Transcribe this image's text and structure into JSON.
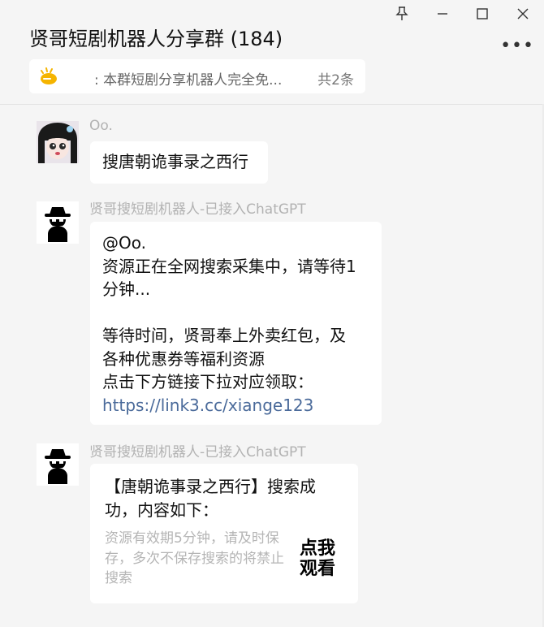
{
  "window": {
    "title": "贤哥短剧机器人分享群 (184)",
    "controls": [
      "pin-icon",
      "minimize-icon",
      "maximize-icon",
      "close-icon"
    ],
    "more_label": "•••"
  },
  "notice": {
    "icon": "bulb-icon",
    "text": ": 本群短剧分享机器人完全免...",
    "count": "共2条"
  },
  "messages": [
    {
      "sender": "Oo.",
      "avatar": "anime-girl-avatar",
      "lines": [
        "搜唐朝诡事录之西行"
      ]
    },
    {
      "sender": "贤哥搜短剧机器人-已接入ChatGPT",
      "avatar": "spy-avatar",
      "lines": [
        "@Oo.",
        "资源正在全网搜索采集中，请等待1",
        "分钟...",
        "",
        "等待时间，贤哥奉上外卖红包，及",
        "各种优惠券等福利资源",
        "点击下方链接下拉对应领取：",
        "https://link3.cc/xiange123"
      ]
    },
    {
      "sender": "贤哥搜短剧机器人-已接入ChatGPT",
      "avatar": "spy-avatar",
      "card": {
        "title_lines": [
          "【唐朝诡事录之西行】搜索成",
          "功，内容如下："
        ],
        "subtitle": "资源有效期5分钟，请及时保存，多次不保存搜索的将禁止搜索",
        "thumb_lines": [
          "点我",
          "观看"
        ]
      }
    }
  ]
}
